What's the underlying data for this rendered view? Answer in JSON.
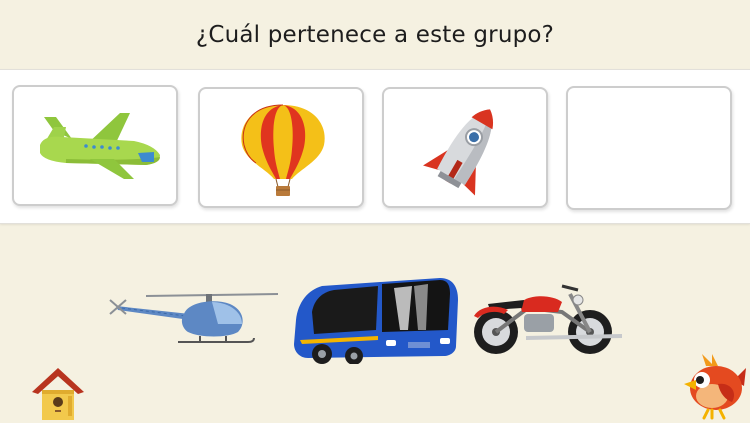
{
  "question": "¿Cuál pertenece a este grupo?",
  "group": {
    "cards": [
      {
        "item": "airplane-icon"
      },
      {
        "item": "hot-air-balloon-icon"
      },
      {
        "item": "rocket-icon"
      },
      {
        "item": "empty-slot"
      }
    ]
  },
  "options": [
    {
      "item": "helicopter-icon"
    },
    {
      "item": "bus-icon"
    },
    {
      "item": "motorcycle-icon"
    }
  ],
  "controls": {
    "home": "birdhouse-icon",
    "mascot": "red-bird-icon"
  },
  "colors": {
    "background": "#f5f1e1",
    "panel": "#ffffff",
    "card_border": "#cdcdcd"
  }
}
